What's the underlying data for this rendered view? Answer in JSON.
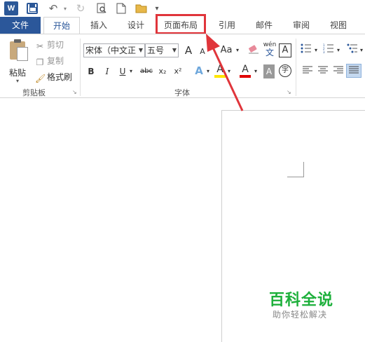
{
  "quick_access": {
    "logo_text": "W",
    "customize_glyph": "▾"
  },
  "tabs": [
    {
      "label": "文件"
    },
    {
      "label": "开始"
    },
    {
      "label": "插入"
    },
    {
      "label": "设计"
    },
    {
      "label": "页面布局"
    },
    {
      "label": "引用"
    },
    {
      "label": "邮件"
    },
    {
      "label": "审阅"
    },
    {
      "label": "视图"
    }
  ],
  "clipboard": {
    "paste": "粘贴",
    "cut": "剪切",
    "copy": "复制",
    "format_painter": "格式刷",
    "group_label": "剪贴板"
  },
  "font": {
    "font_name": "宋体（中文正",
    "font_size": "五号",
    "group_label": "字体",
    "grow": "A",
    "shrink": "A",
    "change_case": "Aa",
    "phonetic_top": "wén",
    "phonetic_bottom": "文",
    "char_border": "A",
    "bold": "B",
    "italic": "I",
    "underline": "U",
    "strikethrough": "abc",
    "subscript": "x₂",
    "superscript": "x²",
    "text_effects": "A",
    "highlight": "A",
    "font_color": "A",
    "char_shading": "A",
    "enclose": "字"
  },
  "colors": {
    "accent": "#2b579a",
    "highlight_box": "#e0353b",
    "watermark": "#1db03b"
  },
  "watermark": {
    "title": "百科全说",
    "subtitle": "助你轻松解决"
  }
}
